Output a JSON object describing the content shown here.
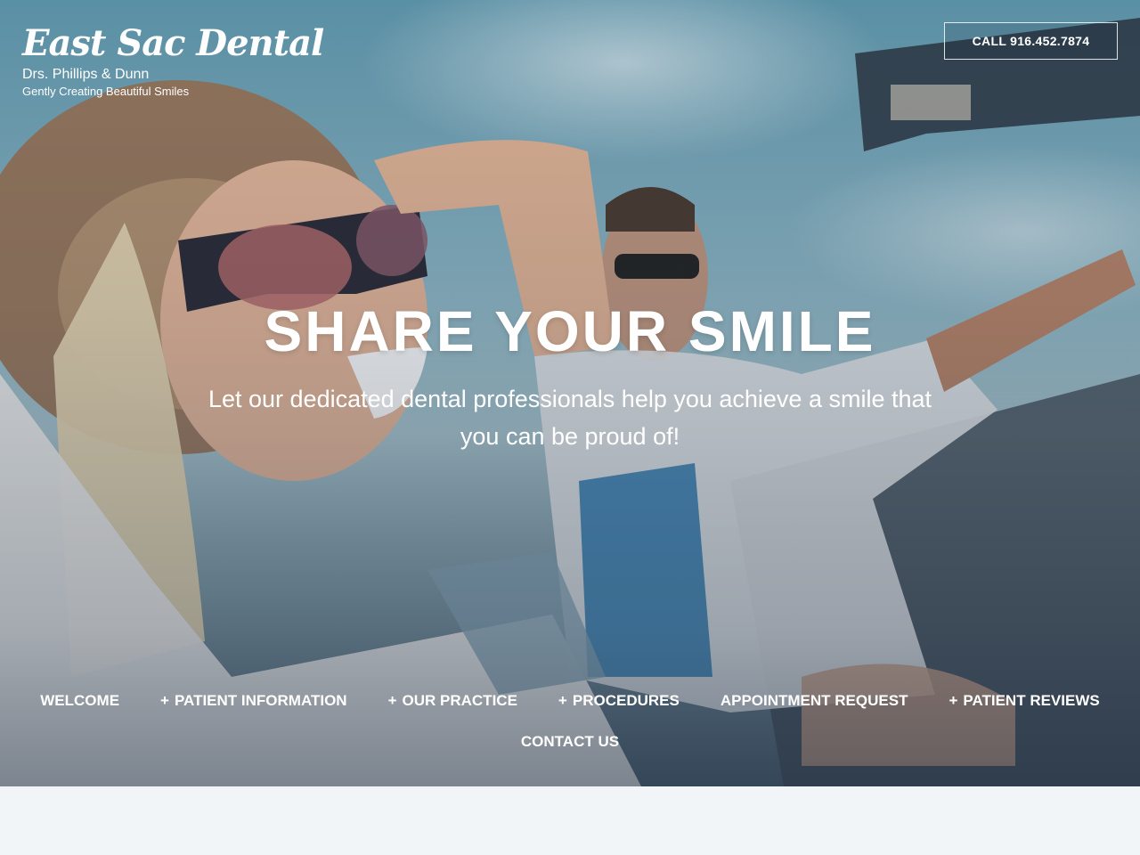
{
  "header": {
    "brand": "East Sac Dental",
    "doctors": "Drs. Phillips & Dunn",
    "tagline": "Gently Creating Beautiful Smiles",
    "call_label": "CALL 916.452.7874"
  },
  "hero": {
    "headline": "SHARE YOUR SMILE",
    "subhead": "Let our dedicated dental professionals help you achieve a smile that you can be proud of!"
  },
  "nav": {
    "items": [
      {
        "label": "WELCOME",
        "has_submenu": false
      },
      {
        "label": "PATIENT INFORMATION",
        "has_submenu": true
      },
      {
        "label": "OUR PRACTICE",
        "has_submenu": true
      },
      {
        "label": "PROCEDURES",
        "has_submenu": true
      },
      {
        "label": "APPOINTMENT REQUEST",
        "has_submenu": false
      },
      {
        "label": "PATIENT REVIEWS",
        "has_submenu": true
      },
      {
        "label": "CONTACT US",
        "has_submenu": false
      }
    ],
    "submenu_marker": "+"
  },
  "colors": {
    "text": "#ffffff",
    "page_background": "#f2f5f8"
  }
}
